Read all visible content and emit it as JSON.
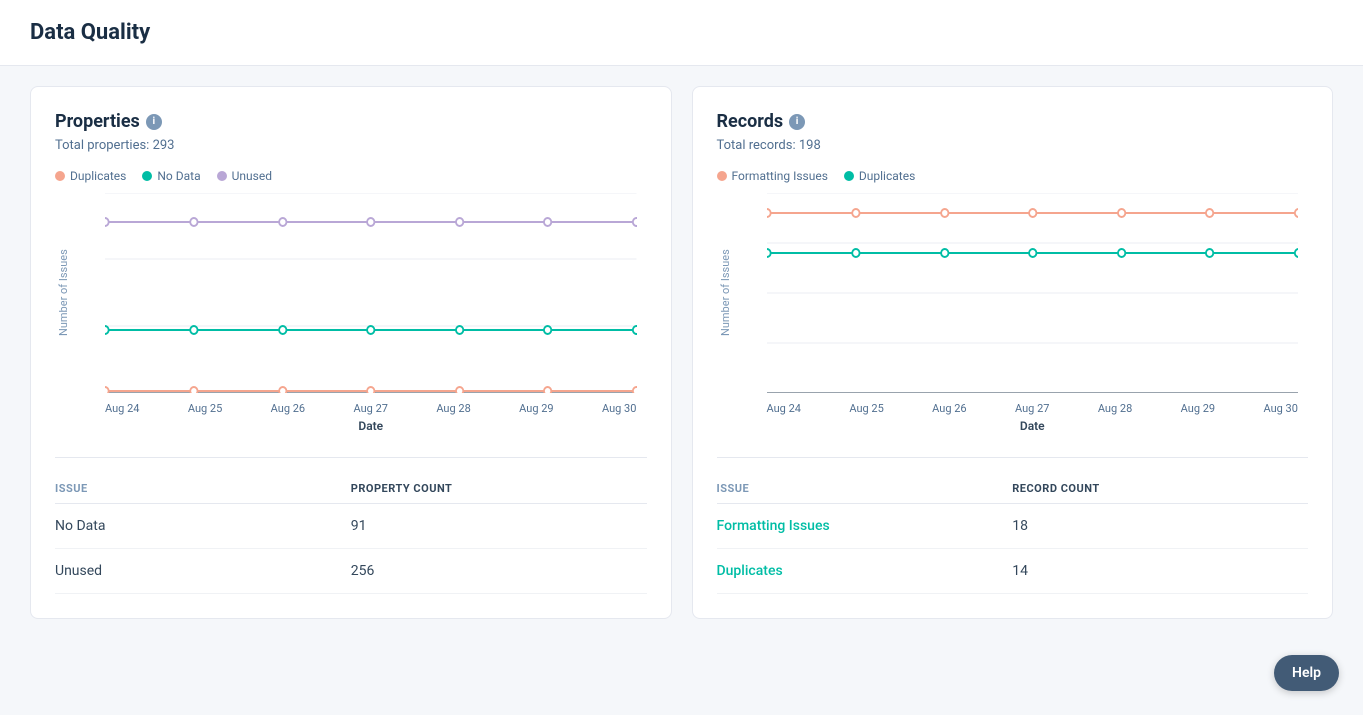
{
  "page": {
    "title": "Data Quality"
  },
  "properties_card": {
    "title": "Properties",
    "subtitle_label": "Total properties:",
    "subtitle_value": "293",
    "legend": [
      {
        "label": "Duplicates",
        "color": "#f5a58e",
        "border_color": "#f5a58e"
      },
      {
        "label": "No Data",
        "color": "#00bda5",
        "border_color": "#00bda5"
      },
      {
        "label": "Unused",
        "color": "#b9a7d6",
        "border_color": "#b9a7d6"
      }
    ],
    "chart": {
      "y_axis_label": "Number of Issues",
      "x_axis_label": "Date",
      "dates": [
        "Aug 24",
        "Aug 25",
        "Aug 26",
        "Aug 27",
        "Aug 28",
        "Aug 29",
        "Aug 30"
      ],
      "series": [
        {
          "name": "Duplicates",
          "color": "#f5a58e",
          "values": [
            1,
            1,
            1,
            1,
            1,
            1,
            1
          ]
        },
        {
          "name": "No Data",
          "color": "#00bda5",
          "values": [
            95,
            95,
            95,
            95,
            95,
            95,
            95
          ]
        },
        {
          "name": "Unused",
          "color": "#b9a7d6",
          "values": [
            257,
            257,
            257,
            257,
            257,
            257,
            257
          ]
        }
      ],
      "y_ticks": [
        0,
        100,
        200,
        300
      ],
      "y_max": 300
    },
    "table": {
      "col1_header": "ISSUE",
      "col2_header": "PROPERTY COUNT",
      "rows": [
        {
          "issue": "No Data",
          "count": "91",
          "link": false
        },
        {
          "issue": "Unused",
          "count": "256",
          "link": false
        }
      ]
    }
  },
  "records_card": {
    "title": "Records",
    "subtitle_label": "Total records:",
    "subtitle_value": "198",
    "legend": [
      {
        "label": "Formatting Issues",
        "color": "#f5a58e",
        "border_color": "#f5a58e"
      },
      {
        "label": "Duplicates",
        "color": "#00bda5",
        "border_color": "#00bda5"
      }
    ],
    "chart": {
      "y_axis_label": "Number of Issues",
      "x_axis_label": "Date",
      "dates": [
        "Aug 24",
        "Aug 25",
        "Aug 26",
        "Aug 27",
        "Aug 28",
        "Aug 29",
        "Aug 30"
      ],
      "series": [
        {
          "name": "Formatting Issues",
          "color": "#f5a58e",
          "values": [
            18,
            18,
            18,
            18,
            18,
            18,
            18
          ]
        },
        {
          "name": "Duplicates",
          "color": "#00bda5",
          "values": [
            14,
            14,
            14,
            14,
            14,
            14,
            14
          ]
        }
      ],
      "y_ticks": [
        0,
        5,
        10,
        15,
        20
      ],
      "y_max": 20
    },
    "table": {
      "col1_header": "ISSUE",
      "col2_header": "RECORD COUNT",
      "rows": [
        {
          "issue": "Formatting Issues",
          "count": "18",
          "link": true
        },
        {
          "issue": "Duplicates",
          "count": "14",
          "link": true
        }
      ]
    }
  },
  "help_button_label": "Help"
}
